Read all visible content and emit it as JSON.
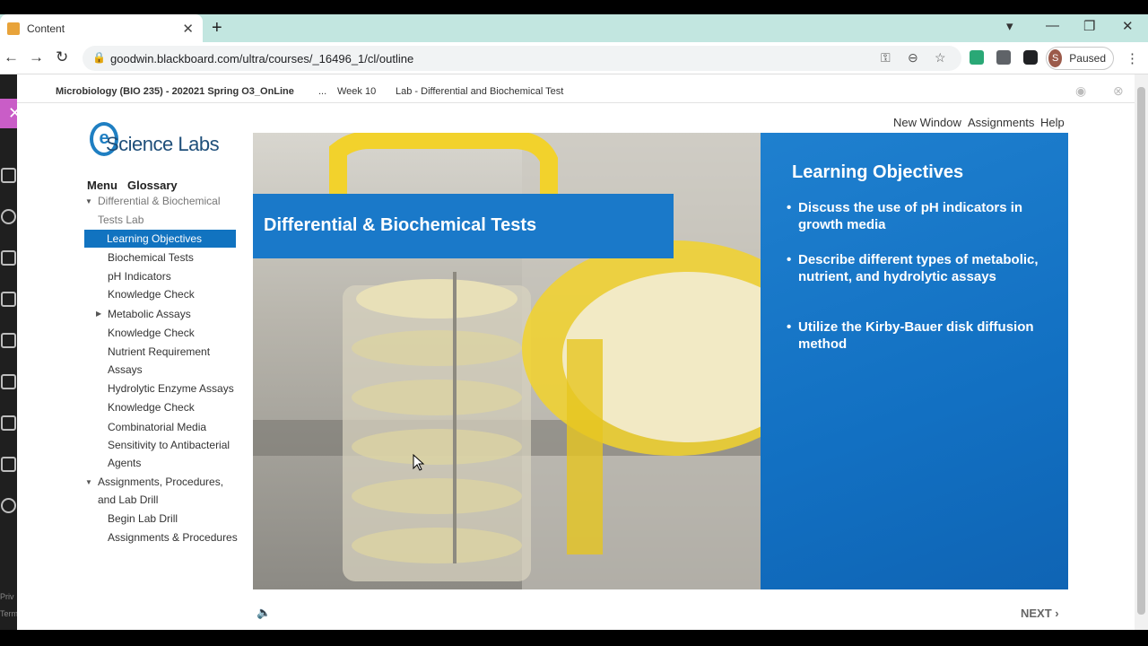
{
  "browser": {
    "tab_title": "Content",
    "url": "goodwin.blackboard.com/ultra/courses/_16496_1/cl/outline",
    "profile_initial": "S",
    "profile_status": "Paused"
  },
  "lms": {
    "course": "Microbiology (BIO 235) - 202021 Spring O3_OnLine",
    "ellipsis": "...",
    "week": "Week 10",
    "page": "Lab - Differential and Biochemical Test"
  },
  "sidebar": {
    "privacy": "Priv",
    "terms": "Term"
  },
  "header_links": {
    "new_window": "New Window",
    "assignments": "Assignments",
    "help": "Help"
  },
  "logo_text": "Science Labs",
  "menu": {
    "menu_label": "Menu",
    "glossary_label": "Glossary",
    "items": [
      "Differential & Biochemical",
      "Tests Lab",
      "Learning Objectives",
      "Biochemical Tests",
      "pH Indicators",
      "Knowledge Check",
      "Metabolic Assays",
      "Knowledge Check",
      "Nutrient Requirement",
      "Assays",
      "Hydrolytic Enzyme Assays",
      "Knowledge Check",
      "Combinatorial Media",
      "Sensitivity to Antibacterial",
      "Agents",
      "Assignments, Procedures,",
      "and Lab Drill",
      "Begin Lab Drill",
      "Assignments & Procedures"
    ]
  },
  "slide": {
    "title": "Differential & Biochemical Tests",
    "objectives_heading": "Learning Objectives",
    "objectives": [
      "Discuss the use of pH indicators in growth media",
      "Describe different types of metabolic, nutrient, and hydrolytic assays",
      "Utilize the Kirby-Bauer disk diffusion method"
    ]
  },
  "nav": {
    "next": "NEXT ›"
  }
}
